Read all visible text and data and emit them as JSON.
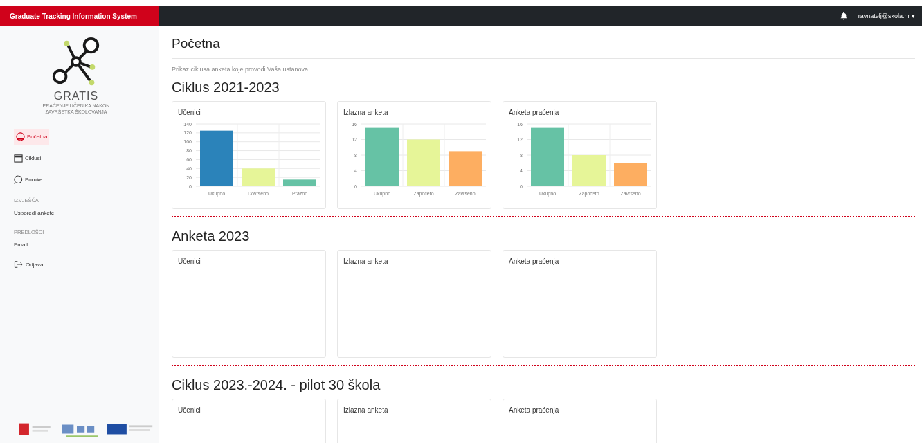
{
  "topbar": {
    "app_title": "Graduate Tracking Information System",
    "user": "ravnatelj@skola.hr",
    "caret": "▾"
  },
  "sidebar": {
    "logo_title": "GRATIS",
    "logo_subtitle": "PRAĆENJE UČENIKA NAKON ZAVRŠETKA ŠKOLOVANJA",
    "items": [
      {
        "kind": "link",
        "label": "Početna",
        "selected": true
      },
      {
        "kind": "link",
        "label": "Ciklusi",
        "selected": false
      },
      {
        "kind": "link",
        "label": "Poruke",
        "selected": false
      },
      {
        "kind": "heading",
        "label": "IZVJEŠĆA"
      },
      {
        "kind": "link",
        "label": "Usporedi ankete",
        "selected": false
      },
      {
        "kind": "heading",
        "label": "PREDLOŠCI"
      },
      {
        "kind": "link",
        "label": "Email",
        "selected": false
      },
      {
        "kind": "link",
        "label": "Odjava",
        "selected": false
      }
    ]
  },
  "page": {
    "title": "Početna",
    "description": "Prikaz ciklusa anketa koje provodi Vaša ustanova."
  },
  "sections": [
    {
      "title": "Ciklus 2021-2023",
      "cards": [
        {
          "title": "Učenici",
          "chart_data": {
            "type": "bar",
            "categories": [
              "Ukupno",
              "Dovršeno",
              "Prazno"
            ],
            "values": [
              125,
              40,
              15
            ],
            "colors": [
              "#2b83ba",
              "#e6f598",
              "#66c2a5"
            ],
            "ylim": [
              0,
              140
            ],
            "yticks": [
              0,
              20,
              40,
              60,
              80,
              100,
              120,
              140
            ],
            "grid": true
          }
        },
        {
          "title": "Izlazna anketa",
          "chart_data": {
            "type": "bar",
            "categories": [
              "Ukupno",
              "Započeto",
              "Završeno"
            ],
            "values": [
              15,
              12,
              9
            ],
            "colors": [
              "#66c2a5",
              "#e6f598",
              "#fdae61"
            ],
            "ylim": [
              0,
              16
            ],
            "yticks": [
              0,
              4,
              8,
              12,
              16
            ],
            "grid": true
          }
        },
        {
          "title": "Anketa praćenja",
          "chart_data": {
            "type": "bar",
            "categories": [
              "Ukupno",
              "Započeto",
              "Završeno"
            ],
            "values": [
              15,
              8,
              6
            ],
            "colors": [
              "#66c2a5",
              "#e6f598",
              "#fdae61"
            ],
            "ylim": [
              0,
              16
            ],
            "yticks": [
              0,
              4,
              8,
              12,
              16
            ],
            "grid": true
          }
        }
      ]
    },
    {
      "title": "Anketa 2023",
      "cards": [
        {
          "title": "Učenici"
        },
        {
          "title": "Izlazna anketa"
        },
        {
          "title": "Anketa praćenja"
        }
      ]
    },
    {
      "title": "Ciklus 2023.-2024. - pilot 30 škola",
      "cards": [
        {
          "title": "Učenici"
        },
        {
          "title": "Izlazna anketa"
        },
        {
          "title": "Anketa praćenja"
        }
      ]
    }
  ]
}
